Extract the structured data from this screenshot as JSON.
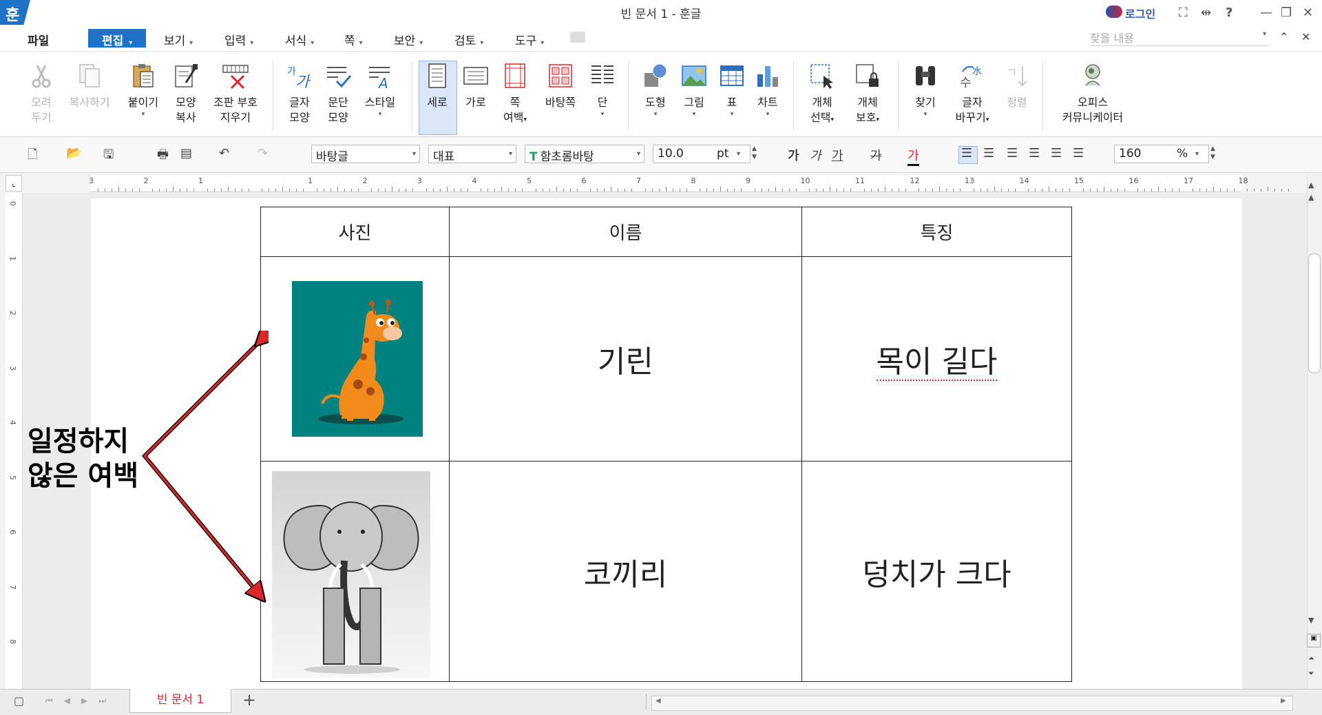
{
  "window": {
    "logo": "훈",
    "title": "빈 문서 1 - 훈글",
    "login": "로그인",
    "controls": {
      "fullscreen": "⛶",
      "expand": "⇹",
      "help": "?",
      "minimize": "—",
      "restore": "❐",
      "close": "✕"
    }
  },
  "menubar": {
    "file": "파일",
    "edit": "편집",
    "items": [
      "보기",
      "입력",
      "서식",
      "쪽",
      "보안",
      "검토",
      "도구"
    ],
    "find_placeholder": "찾을 내용"
  },
  "ribbon": {
    "cut": [
      "오려",
      "두기"
    ],
    "copy": [
      "복사하기"
    ],
    "paste": [
      "붙이기"
    ],
    "format_copy": [
      "모양",
      "복사"
    ],
    "clear_marks": [
      "조판 부호",
      "지우기"
    ],
    "char_shape": [
      "글자",
      "모양"
    ],
    "para_shape": [
      "문단",
      "모양"
    ],
    "style": [
      "스타일"
    ],
    "portrait": [
      "세로"
    ],
    "landscape": [
      "가로"
    ],
    "page_margin": [
      "쪽",
      "여백"
    ],
    "bg_page": [
      "바탕쪽"
    ],
    "column": [
      "단"
    ],
    "shape": [
      "도형"
    ],
    "picture": [
      "그림"
    ],
    "table": [
      "표"
    ],
    "chart": [
      "차트"
    ],
    "obj_select": [
      "개체",
      "선택"
    ],
    "obj_protect": [
      "개체",
      "보호"
    ],
    "find": [
      "찾기"
    ],
    "replace": [
      "글자",
      "바꾸기"
    ],
    "sort": [
      "정렬"
    ],
    "communicator": [
      "오피스",
      "커뮤니케이터"
    ]
  },
  "toolbar2": {
    "style": "바탕글",
    "lang": "대표",
    "font": "함초롬바탕",
    "size": "10.0",
    "unit": "pt",
    "zoom": "160",
    "zoom_unit": "%",
    "font_icon": "T",
    "bold": "가",
    "italic": "가",
    "underline": "가",
    "strike": "가",
    "color": "가"
  },
  "ruler": {
    "h_ticks": [
      "3",
      "2",
      "1",
      "",
      "1",
      "2",
      "3",
      "4",
      "5",
      "6",
      "7",
      "8",
      "9",
      "10",
      "11",
      "12",
      "13",
      "14",
      "15",
      "16",
      "17",
      "18"
    ],
    "v_ticks": [
      "0",
      "1",
      "2",
      "3",
      "4",
      "5",
      "6",
      "7",
      "8"
    ]
  },
  "table": {
    "headers": [
      "사진",
      "이름",
      "특징"
    ],
    "rows": [
      {
        "name": "기린",
        "feature": "목이 길다"
      },
      {
        "name": "코끼리",
        "feature": "덩치가 크다"
      }
    ]
  },
  "annotation": {
    "line1": "일정하지",
    "line2": "않은 여백",
    "color": "#e0262b"
  },
  "statusbar": {
    "tab": "빈 문서 1",
    "add": "+"
  }
}
